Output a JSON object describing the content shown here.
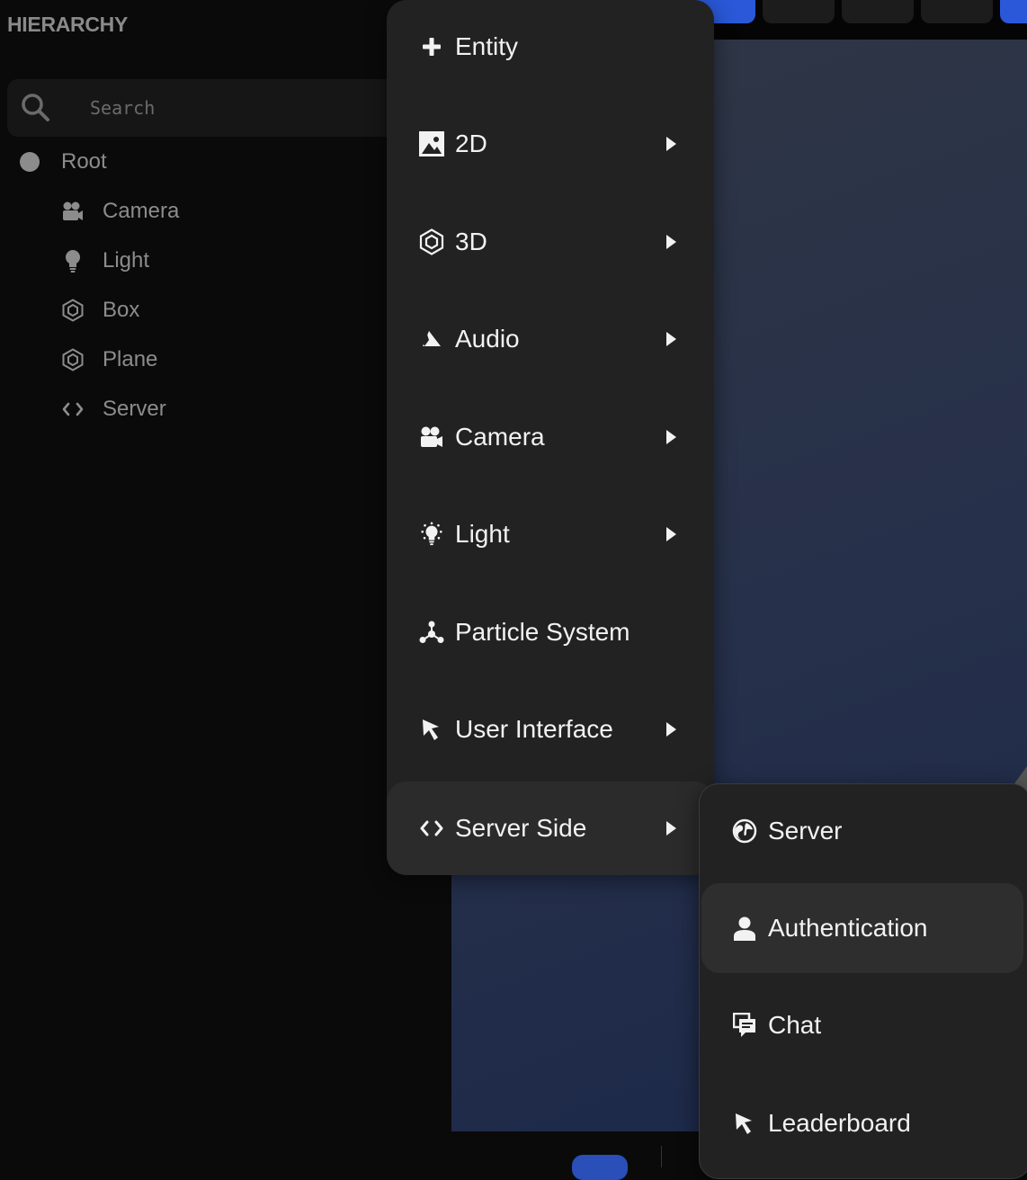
{
  "hierarchy": {
    "title": "HIERARCHY",
    "search": {
      "placeholder": "Search",
      "value": ""
    },
    "tree": {
      "root": "Root",
      "children": [
        {
          "label": "Camera",
          "icon": "camera-icon"
        },
        {
          "label": "Light",
          "icon": "lightbulb-icon"
        },
        {
          "label": "Box",
          "icon": "hexagon-icon"
        },
        {
          "label": "Plane",
          "icon": "hexagon-icon"
        },
        {
          "label": "Server",
          "icon": "code-icon"
        }
      ]
    }
  },
  "menu": {
    "items": [
      {
        "label": "Entity",
        "icon": "plus-icon",
        "submenu": false
      },
      {
        "label": "2D",
        "icon": "image-icon",
        "submenu": true
      },
      {
        "label": "3D",
        "icon": "hexagon-icon",
        "submenu": true
      },
      {
        "label": "Audio",
        "icon": "audio-cone-icon",
        "submenu": true
      },
      {
        "label": "Camera",
        "icon": "camera-icon",
        "submenu": true
      },
      {
        "label": "Light",
        "icon": "lightbulb-icon",
        "submenu": true
      },
      {
        "label": "Particle System",
        "icon": "particles-icon",
        "submenu": false
      },
      {
        "label": "User Interface",
        "icon": "cursor-arrow-icon",
        "submenu": true
      },
      {
        "label": "Server Side",
        "icon": "code-icon",
        "submenu": true,
        "active": true
      }
    ]
  },
  "submenu": {
    "items": [
      {
        "label": "Server",
        "icon": "globe-icon"
      },
      {
        "label": "Authentication",
        "icon": "user-icon",
        "hovered": true
      },
      {
        "label": "Chat",
        "icon": "chat-icon"
      },
      {
        "label": "Leaderboard",
        "icon": "cursor-arrow-icon"
      }
    ]
  },
  "colors": {
    "menu_bg": "#222222",
    "accent_blue": "#2a58d8",
    "panel_text": "#8c8c8c",
    "menu_text": "#f2f2f2"
  }
}
